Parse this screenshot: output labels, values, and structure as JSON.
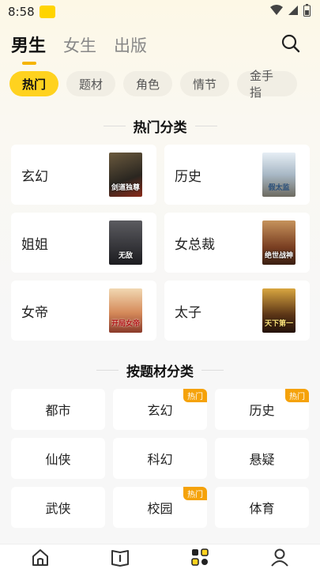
{
  "status": {
    "time": "8:58",
    "app_badge": "QQ阅读"
  },
  "top_tabs": [
    {
      "label": "男生"
    },
    {
      "label": "女生"
    },
    {
      "label": "出版"
    }
  ],
  "chips": [
    {
      "label": "热门"
    },
    {
      "label": "题材"
    },
    {
      "label": "角色"
    },
    {
      "label": "情节"
    },
    {
      "label": "金手指"
    }
  ],
  "hot_section": {
    "title": "热门分类",
    "items": [
      {
        "label": "玄幻",
        "cover_text": "剑道独尊",
        "cover_color": "#3c3a35"
      },
      {
        "label": "历史",
        "cover_text": "假太监",
        "cover_color": "#b8c9d8"
      },
      {
        "label": "姐姐",
        "cover_text": "无敌",
        "cover_color": "#1d1d22"
      },
      {
        "label": "女总裁",
        "cover_text": "绝世战神",
        "cover_color": "#7a4a2a"
      },
      {
        "label": "女帝",
        "cover_text": "开局女帝",
        "cover_color": "#c9a27a"
      },
      {
        "label": "太子",
        "cover_text": "天下第一",
        "cover_color": "#3a2a18"
      }
    ]
  },
  "theme_section": {
    "title": "按题材分类",
    "hot_tag": "热门",
    "items": [
      {
        "label": "都市",
        "hot": false
      },
      {
        "label": "玄幻",
        "hot": true
      },
      {
        "label": "历史",
        "hot": true
      },
      {
        "label": "仙侠",
        "hot": false
      },
      {
        "label": "科幻",
        "hot": false
      },
      {
        "label": "悬疑",
        "hot": false
      },
      {
        "label": "武侠",
        "hot": false
      },
      {
        "label": "校园",
        "hot": true
      },
      {
        "label": "体育",
        "hot": false
      }
    ]
  },
  "colors": {
    "accent": "#ffd21f",
    "hot_tag": "#f5a20a",
    "indicator": "#f5b400"
  }
}
